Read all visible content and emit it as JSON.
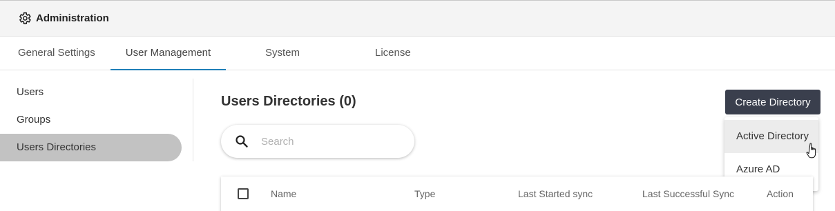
{
  "header": {
    "title": "Administration",
    "icon": "gear-icon"
  },
  "tabs": [
    {
      "label": "General Settings"
    },
    {
      "label": "User Management",
      "active": true
    },
    {
      "label": "System"
    },
    {
      "label": "License"
    }
  ],
  "sidebar": {
    "items": [
      {
        "label": "Users"
      },
      {
        "label": "Groups"
      },
      {
        "label": "Users Directories",
        "active": true
      }
    ]
  },
  "main": {
    "title": "Users Directories (0)",
    "search": {
      "placeholder": "Search",
      "value": ""
    },
    "create_button": "Create Directory",
    "dropdown": [
      {
        "label": "Active Directory",
        "hovered": true
      },
      {
        "label": "Azure AD"
      }
    ],
    "table": {
      "columns": [
        "Name",
        "Type",
        "Last Started sync",
        "Last Successful Sync",
        "Action"
      ]
    }
  },
  "colors": {
    "accent": "#1f7fb8",
    "button_bg": "#3a3f4d",
    "sidebar_active": "#c2c2c2"
  }
}
